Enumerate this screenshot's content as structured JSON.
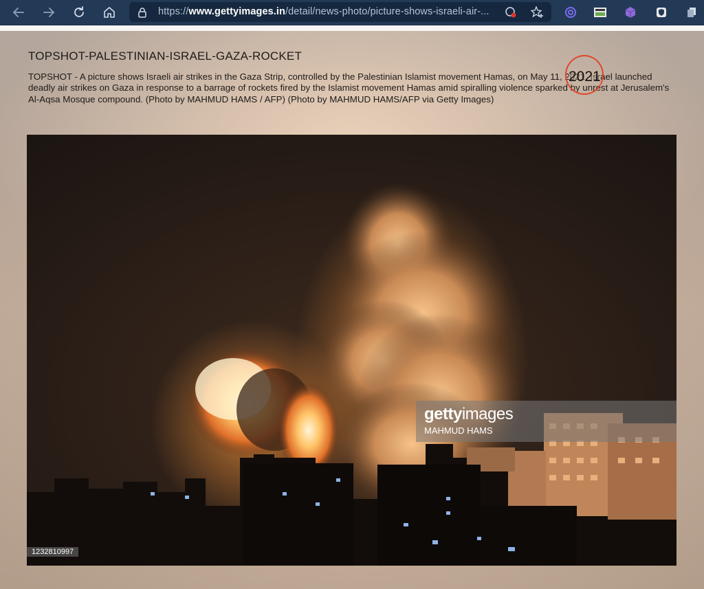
{
  "browser": {
    "url_prefix": "https://",
    "url_host": "www.gettyimages.in",
    "url_path": "/detail/news-photo/picture-shows-israeli-air-..."
  },
  "article": {
    "title": "TOPSHOT-PALESTINIAN-ISRAEL-GAZA-ROCKET",
    "caption": "TOPSHOT - A picture shows Israeli air strikes in the Gaza Strip, controlled by the Palestinian Islamist movement Hamas, on May 11, 2021. Israel launched deadly air strikes on Gaza in response to a barrage of rockets fired by the Islamist movement Hamas amid spiralling violence sparked by unrest at Jerusalem's Al-Aqsa Mosque compound. (Photo by MAHMUD HAMS / AFP) (Photo by MAHMUD HAMS/AFP via Getty Images)",
    "highlight_year": "2021"
  },
  "photo": {
    "watermark_logo_bold": "getty",
    "watermark_logo_light": "images",
    "watermark_credit": "MAHMUD HAMS",
    "image_id": "1232810997"
  },
  "colors": {
    "toolbar": "#233a57",
    "highlight_circle": "#e0452b"
  }
}
